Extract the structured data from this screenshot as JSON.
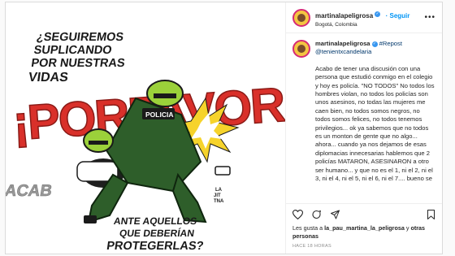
{
  "post": {
    "username": "martinalapeligrosa",
    "follow_label": "Seguir",
    "location": "Bogotá, Colombia",
    "caption": {
      "username": "martinalapeligrosa",
      "hashtag": "#Repost",
      "mention": "@tenientxcandelaria",
      "text": "Acabo de tener una discusión con una persona que estudió conmigo en el colegio y hoy es policía. \"NO TODOS\" No todos los hombres violan, no todos los policías son unos asesinos, no todas las mujeres me caen bien, no todos somos negros, no todos somos felices, no todos tenemos privilegios... ok ya sabemos que no todos es un monton de gente que no algo... ahora... cuando ya nos dejamos de esas diplomacias innecesarias hablemos que 2 policías MATARON, ASESINARON a otro ser humano... y que no es el 1, ni el 2, ni el 3, ni el 4, ni el 5, ni el 6, ni el 7.... bueno se"
    },
    "likes": {
      "prefix": "Les gusta a",
      "user1": "la_pau_martina",
      "user2": "la_peligrosa",
      "and": "y",
      "others": "otras personas"
    },
    "time": "HACE 18 HORAS"
  },
  "poster": {
    "top_line1": "¿SEGUIREMOS",
    "top_line2": "SUPLICANDO",
    "top_line3": "POR NUESTRAS",
    "top_line4": "VIDAS",
    "big_word": "¡PORFAVOR!",
    "acab": "ACAB",
    "police_label": "POLICIA",
    "bottom_line1": "ANTE AQUELLOS",
    "bottom_line2": "QUE DEBERÍAN",
    "bottom_line3": "PROTEGERLAS?",
    "artist_line1": "LA",
    "artist_line2": "JIT",
    "artist_line3": "TNA"
  },
  "colors": {
    "red": "#d9302a",
    "green": "#2e5e2a",
    "helmet": "#9bd13a",
    "link": "#0095f6"
  },
  "icons": [
    "heart-icon",
    "comment-icon",
    "share-icon",
    "bookmark-icon",
    "more-icon",
    "verified-icon"
  ]
}
